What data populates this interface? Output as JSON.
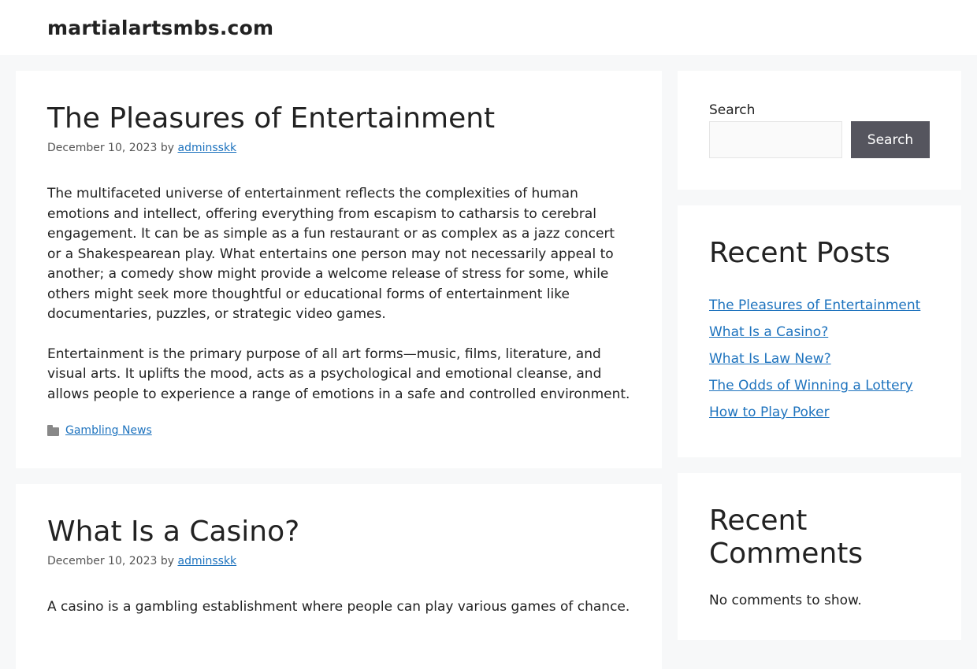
{
  "site": {
    "title": "martialartsmbs.com"
  },
  "posts": [
    {
      "title": "The Pleasures of Entertainment",
      "date": "December 10, 2023",
      "by": "by",
      "author": "adminsskk",
      "paragraphs": [
        "The multifaceted universe of entertainment reflects the complexities of human emotions and intellect, offering everything from escapism to catharsis to cerebral engagement. It can be as simple as a fun restaurant or as complex as a jazz concert or a Shakespearean play. What entertains one person may not necessarily appeal to another; a comedy show might provide a welcome release of stress for some, while others might seek more thoughtful or educational forms of entertainment like documentaries, puzzles, or strategic video games.",
        "Entertainment is the primary purpose of all art forms—music, films, literature, and visual arts. It uplifts the mood, acts as a psychological and emotional cleanse, and allows people to experience a range of emotions in a safe and controlled environment."
      ],
      "category": "Gambling News"
    },
    {
      "title": "What Is a Casino?",
      "date": "December 10, 2023",
      "by": "by",
      "author": "adminsskk",
      "paragraphs": [
        "A casino is a gambling establishment where people can play various games of chance."
      ]
    }
  ],
  "sidebar": {
    "search": {
      "label": "Search",
      "button": "Search",
      "value": ""
    },
    "recent_posts": {
      "title": "Recent Posts",
      "items": [
        "The Pleasures of Entertainment",
        "What Is a Casino?",
        "What Is Law New?",
        "The Odds of Winning a Lottery",
        "How to Play Poker"
      ]
    },
    "recent_comments": {
      "title": "Recent Comments",
      "empty": "No comments to show."
    }
  },
  "icons": {
    "category": "folder-icon"
  },
  "colors": {
    "link": "#1e73be",
    "search_button": "#55555e",
    "page_bg": "#f7f8f9"
  }
}
